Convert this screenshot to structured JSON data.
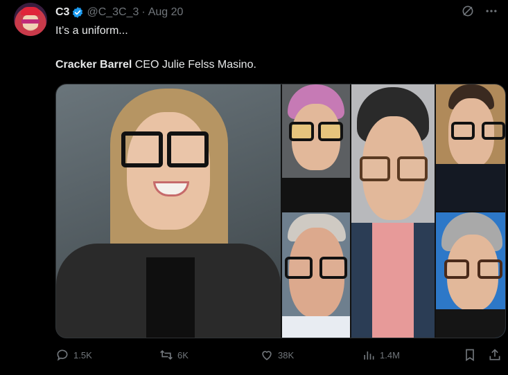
{
  "author": {
    "name": "C3",
    "handle": "@C_3C_3",
    "separator": "·",
    "date": "Aug 20"
  },
  "post": {
    "line1": "It’s a uniform...",
    "line2_bold": "Cracker Barrel",
    "line2_rest": " CEO Julie Felss Masino."
  },
  "actions": {
    "replies": "1.5K",
    "reposts": "6K",
    "likes": "38K",
    "views": "1.4M"
  },
  "icons": {
    "verified": "verified-badge-icon",
    "grok": "grok-icon",
    "more": "more-icon",
    "reply": "reply-icon",
    "repost": "repost-icon",
    "like": "heart-icon",
    "views": "views-icon",
    "bookmark": "bookmark-icon",
    "share": "share-icon"
  },
  "colors": {
    "verified": "#1d9bf0",
    "muted": "#71767b",
    "text": "#e7e9ea",
    "background": "#000000"
  }
}
